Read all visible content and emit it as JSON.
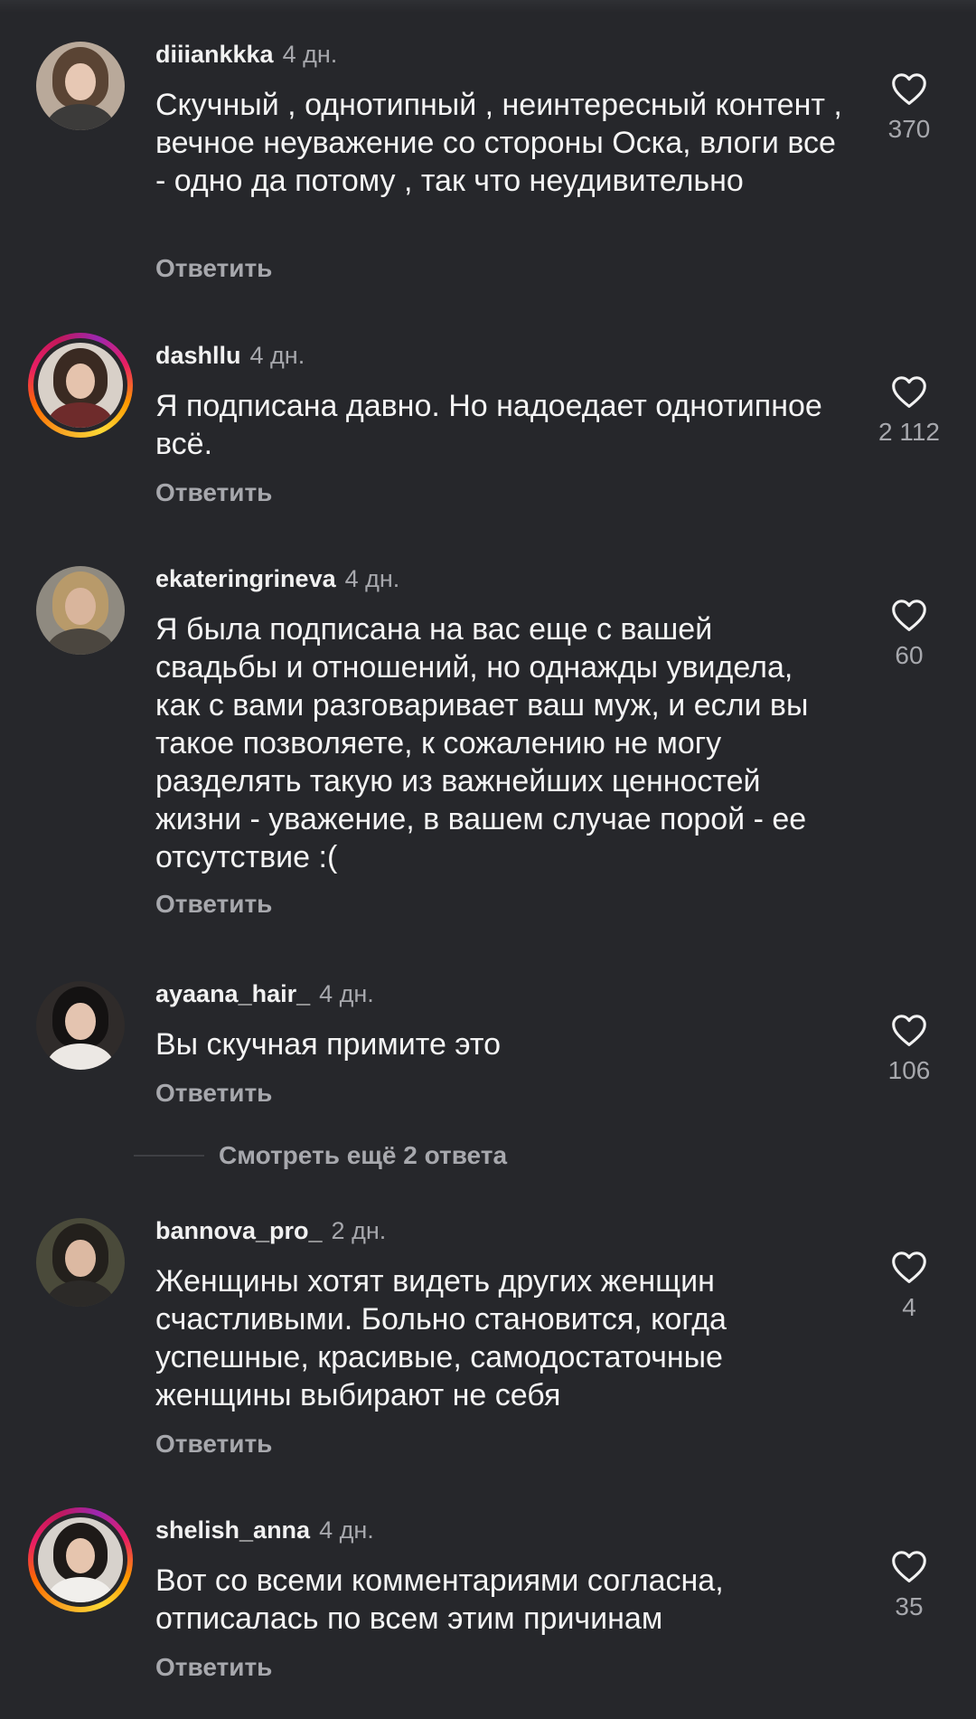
{
  "comments": [
    {
      "username": "diiiankkka",
      "time": "4 дн.",
      "text": "Скучный , однотипный , неинтересный контент , вечное неуважение со стороны Оска, влоги все - одно да потому , так что неудивительно",
      "reply_label": "Ответить",
      "likes": "370",
      "story_ring": false
    },
    {
      "username": "dashllu",
      "time": "4 дн.",
      "text": "Я подписана давно. Но надоедает однотипное всё.",
      "reply_label": "Ответить",
      "likes": "2 112",
      "story_ring": true
    },
    {
      "username": "ekateringrineva",
      "time": "4 дн.",
      "text": "Я была подписана на вас еще с вашей свадьбы и отношений, но однажды увидела, как с вами разговаривает ваш муж, и если вы такое позволяете, к сожалению не могу разделять такую из важнейших ценностей жизни - уважение, в вашем случае порой - ее отсутствие :(",
      "reply_label": "Ответить",
      "likes": "60",
      "story_ring": false
    },
    {
      "username": "ayaana_hair_",
      "time": "4 дн.",
      "text": "Вы скучная примите это",
      "reply_label": "Ответить",
      "likes": "106",
      "story_ring": false
    },
    {
      "username": "bannova_pro_",
      "time": "2 дн.",
      "text": "Женщины хотят видеть других женщин счастливыми. Больно становится, когда успешные, красивые, самодостаточные женщины выбирают не себя",
      "reply_label": "Ответить",
      "likes": "4",
      "story_ring": false
    },
    {
      "username": "shelish_anna",
      "time": "4 дн.",
      "text": "Вот со всеми комментариями согласна, отписалась по всем этим причинам",
      "reply_label": "Ответить",
      "likes": "35",
      "story_ring": true
    }
  ],
  "view_more_replies": "Смотреть ещё 2 ответа",
  "colors": {
    "background": "#26272b",
    "text": "#f4f4f4",
    "muted": "#a7a8ad",
    "story_ring": [
      "#f9a825",
      "#e91e63",
      "#9c27b0"
    ]
  },
  "icons": {
    "like": "heart-outline-icon"
  }
}
